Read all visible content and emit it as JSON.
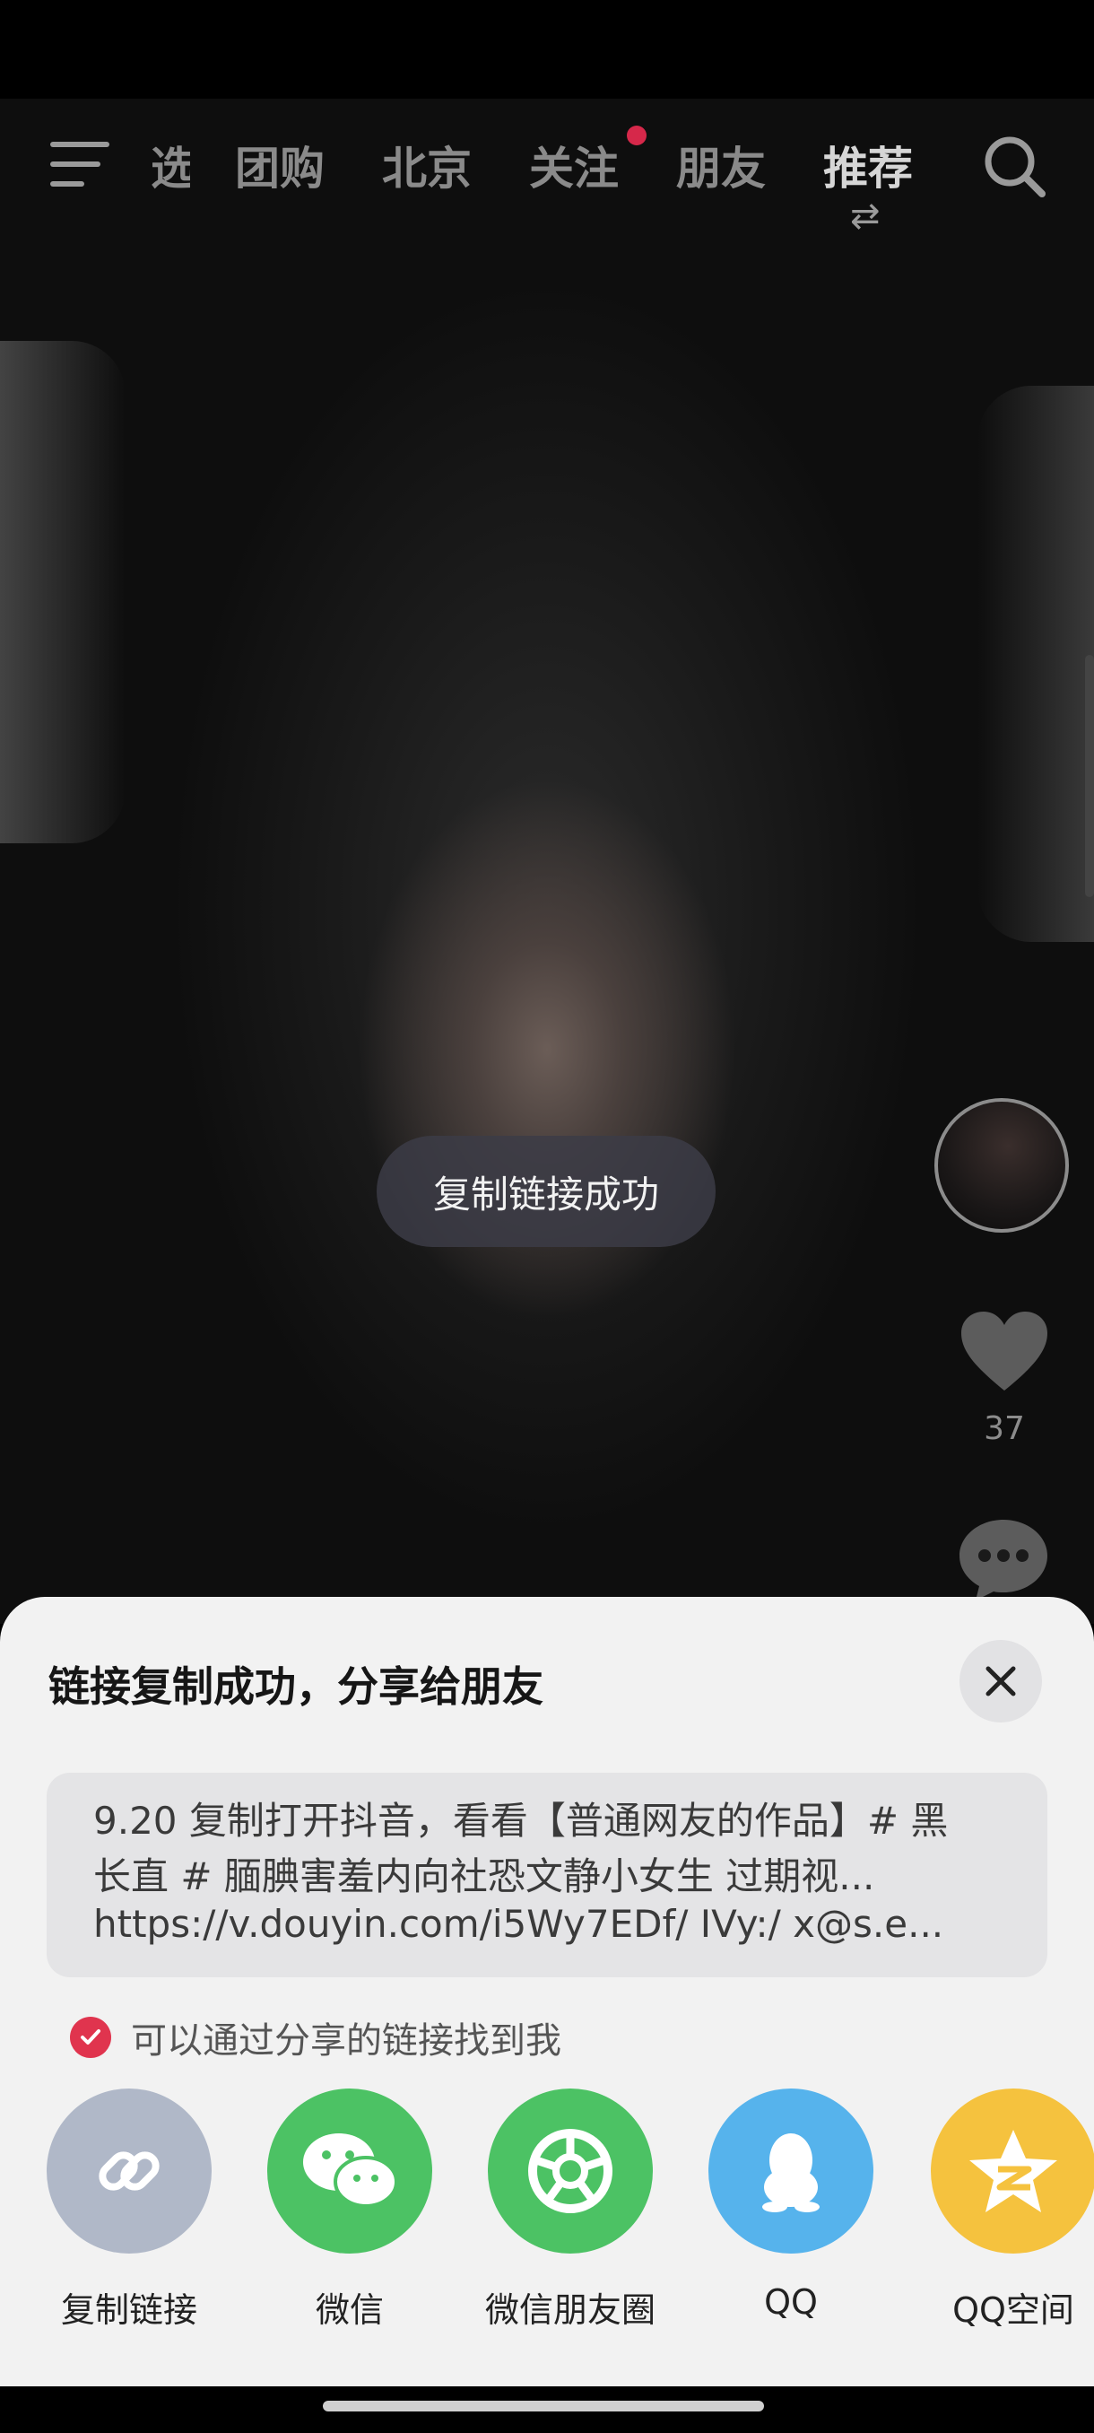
{
  "nav": {
    "tabs": [
      {
        "label": "选"
      },
      {
        "label": "团购"
      },
      {
        "label": "北京"
      },
      {
        "label": "关注"
      },
      {
        "label": "朋友"
      },
      {
        "label": "推荐"
      }
    ],
    "icons": {
      "menu": "menu-icon",
      "search": "search-icon",
      "swap": "swap-icon"
    }
  },
  "video": {
    "like_count": "37",
    "toast": "复制链接成功"
  },
  "sheet": {
    "title": "链接复制成功，分享给朋友",
    "link_lines": [
      "9.20 复制打开抖音，看看【普通网友的作品】# 黑",
      "长直 # 腼腆害羞内向社恐文静小女生 过期视...",
      "https://v.douyin.com/i5Wy7EDf/ IVy:/ x@s.e..."
    ],
    "checkbox_label": "可以通过分享的链接找到我",
    "checkbox_checked": true,
    "share_targets": [
      {
        "label": "复制链接",
        "icon": "link-icon",
        "color": "#b0b8c8"
      },
      {
        "label": "微信",
        "icon": "wechat-icon",
        "color": "#4cc264"
      },
      {
        "label": "微信朋友圈",
        "icon": "moments-icon",
        "color": "#4cc264"
      },
      {
        "label": "QQ",
        "icon": "qq-icon",
        "color": "#56b3ec"
      },
      {
        "label": "QQ空间",
        "icon": "qzone-icon",
        "color": "#f5c23e"
      }
    ]
  },
  "colors": {
    "accent_red": "#e0344e",
    "sheet_bg": "#f2f2f2"
  }
}
